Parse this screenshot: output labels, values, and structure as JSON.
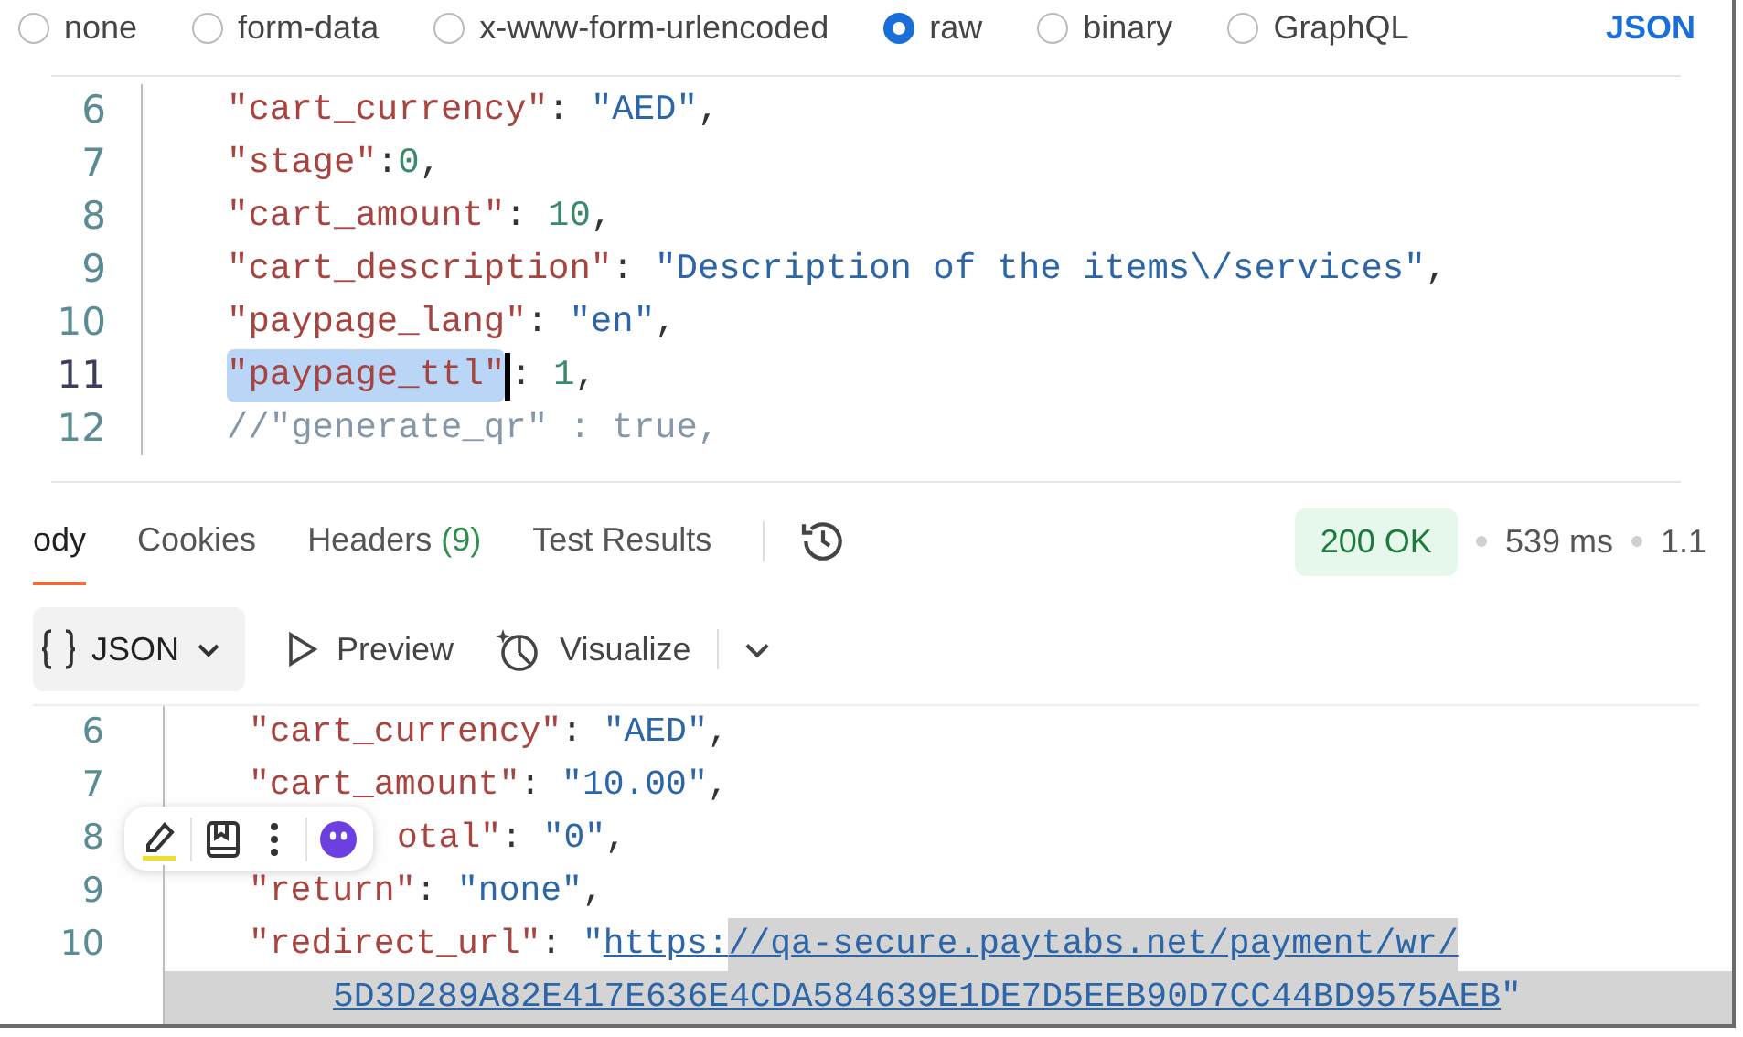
{
  "body_types": [
    {
      "label": "none",
      "selected": false
    },
    {
      "label": "form-data",
      "selected": false
    },
    {
      "label": "x-www-form-urlencoded",
      "selected": false
    },
    {
      "label": "raw",
      "selected": true
    },
    {
      "label": "binary",
      "selected": false
    },
    {
      "label": "GraphQL",
      "selected": false
    }
  ],
  "body_format": "JSON",
  "request_editor": {
    "focused": true,
    "lines": [
      {
        "number": "6",
        "active": false,
        "tokens": [
          {
            "kind": "key",
            "text": "\"cart_currency\""
          },
          {
            "kind": "punct",
            "text": ": "
          },
          {
            "kind": "string",
            "text": "\"AED\""
          },
          {
            "kind": "punct",
            "text": ","
          }
        ]
      },
      {
        "number": "7",
        "active": false,
        "tokens": [
          {
            "kind": "key",
            "text": "\"stage\""
          },
          {
            "kind": "punct",
            "text": ":"
          },
          {
            "kind": "number",
            "text": "0"
          },
          {
            "kind": "punct",
            "text": ","
          }
        ]
      },
      {
        "number": "8",
        "active": false,
        "tokens": [
          {
            "kind": "key",
            "text": "\"cart_amount\""
          },
          {
            "kind": "punct",
            "text": ": "
          },
          {
            "kind": "number",
            "text": "10"
          },
          {
            "kind": "punct",
            "text": ","
          }
        ]
      },
      {
        "number": "9",
        "active": false,
        "tokens": [
          {
            "kind": "key",
            "text": "\"cart_description\""
          },
          {
            "kind": "punct",
            "text": ": "
          },
          {
            "kind": "string",
            "text": "\"Description of the items\\/services\""
          },
          {
            "kind": "punct",
            "text": ","
          }
        ]
      },
      {
        "number": "10",
        "active": false,
        "tokens": [
          {
            "kind": "key",
            "text": "\"paypage_lang\""
          },
          {
            "kind": "punct",
            "text": ": "
          },
          {
            "kind": "string",
            "text": "\"en\""
          },
          {
            "kind": "punct",
            "text": ","
          }
        ]
      },
      {
        "number": "11",
        "active": true,
        "tokens": [
          {
            "kind": "key",
            "text": "\"paypage_ttl\"",
            "selected": true
          },
          {
            "kind": "punct",
            "text": ": "
          },
          {
            "kind": "number",
            "text": "1"
          },
          {
            "kind": "punct",
            "text": ","
          }
        ]
      },
      {
        "number": "12",
        "active": false,
        "tokens": [
          {
            "kind": "comment",
            "text": "//\"generate_qr\" : true,"
          }
        ]
      }
    ]
  },
  "response_tabs": [
    {
      "label": "ody",
      "selected": true
    },
    {
      "label": "Cookies",
      "selected": false
    },
    {
      "label": "Headers",
      "count": "(9)",
      "selected": false
    },
    {
      "label": "Test Results",
      "selected": false
    }
  ],
  "status": {
    "code": "200 OK",
    "time": "539 ms",
    "size": "1.1"
  },
  "response_toolbar": {
    "format": "JSON",
    "preview": "Preview",
    "visualize": "Visualize"
  },
  "response_editor": {
    "focused": false,
    "lines": [
      {
        "number": "6",
        "tokens": [
          {
            "kind": "key",
            "text": "\"cart_currency\""
          },
          {
            "kind": "punct",
            "text": ": "
          },
          {
            "kind": "string",
            "text": "\"AED\""
          },
          {
            "kind": "punct",
            "text": ","
          }
        ]
      },
      {
        "number": "7",
        "tokens": [
          {
            "kind": "key",
            "text": "\"cart_amount\""
          },
          {
            "kind": "punct",
            "text": ": "
          },
          {
            "kind": "string",
            "text": "\"10.00\""
          },
          {
            "kind": "punct",
            "text": ","
          }
        ]
      },
      {
        "number": "8",
        "selection_toolbar": true,
        "tokens": [
          {
            "kind": "key",
            "text": "otal\""
          },
          {
            "kind": "punct",
            "text": ": "
          },
          {
            "kind": "string",
            "text": "\"0\""
          },
          {
            "kind": "punct",
            "text": ","
          }
        ]
      },
      {
        "number": "9",
        "tokens": [
          {
            "kind": "key",
            "text": "\"return\""
          },
          {
            "kind": "punct",
            "text": ": "
          },
          {
            "kind": "string",
            "text": "\"none\""
          },
          {
            "kind": "punct",
            "text": ","
          }
        ]
      },
      {
        "number": "10",
        "tokens": [
          {
            "kind": "key",
            "text": "\"redirect_url\""
          },
          {
            "kind": "punct",
            "text": ": "
          },
          {
            "kind": "string",
            "text": "\""
          },
          {
            "kind": "link",
            "text": "https:"
          },
          {
            "kind": "link",
            "text": "//qa-secure.paytabs.net/payment/wr/",
            "selected": true
          }
        ]
      },
      {
        "continuation": true,
        "selected": true,
        "tokens": [
          {
            "kind": "link",
            "text": "5D3D289A82E417E636E4CDA584639E1DE7D5EEB90D7CC44BD9575AEB"
          },
          {
            "kind": "string",
            "text": "\""
          }
        ]
      }
    ]
  }
}
